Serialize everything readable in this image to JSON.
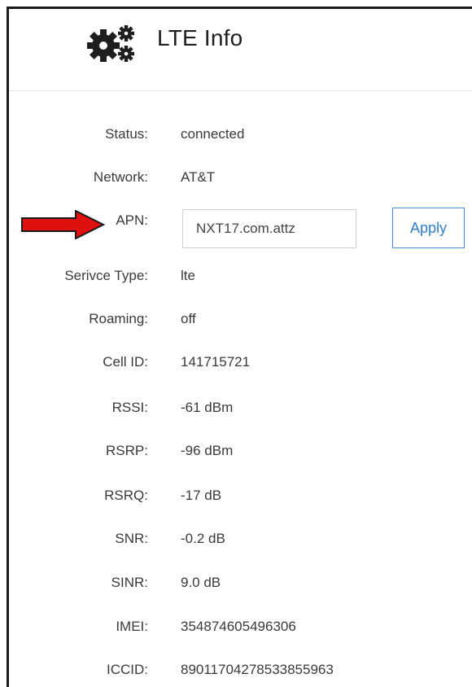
{
  "header": {
    "title": "LTE Info",
    "icon": "gears-icon"
  },
  "rows": [
    {
      "label": "Status:",
      "value": "connected"
    },
    {
      "label": "Network:",
      "value": "AT&T"
    },
    {
      "label": "APN:",
      "value": "NXT17.com.attz"
    },
    {
      "label": "Serivce Type:",
      "value": "lte"
    },
    {
      "label": "Roaming:",
      "value": "off"
    },
    {
      "label": "Cell ID:",
      "value": "141715721"
    },
    {
      "label": "RSSI:",
      "value": "-61 dBm"
    },
    {
      "label": "RSRP:",
      "value": "-96 dBm"
    },
    {
      "label": "RSRQ:",
      "value": "-17 dB"
    },
    {
      "label": "SNR:",
      "value": "-0.2 dB"
    },
    {
      "label": "SINR:",
      "value": "9.0 dB"
    },
    {
      "label": "IMEI:",
      "value": "354874605496306"
    },
    {
      "label": "ICCID:",
      "value": "89011704278533855963"
    }
  ],
  "apn": {
    "apply_label": "Apply"
  },
  "annotation": {
    "arrow_color": "#e01010",
    "icon": "red-arrow-icon"
  }
}
